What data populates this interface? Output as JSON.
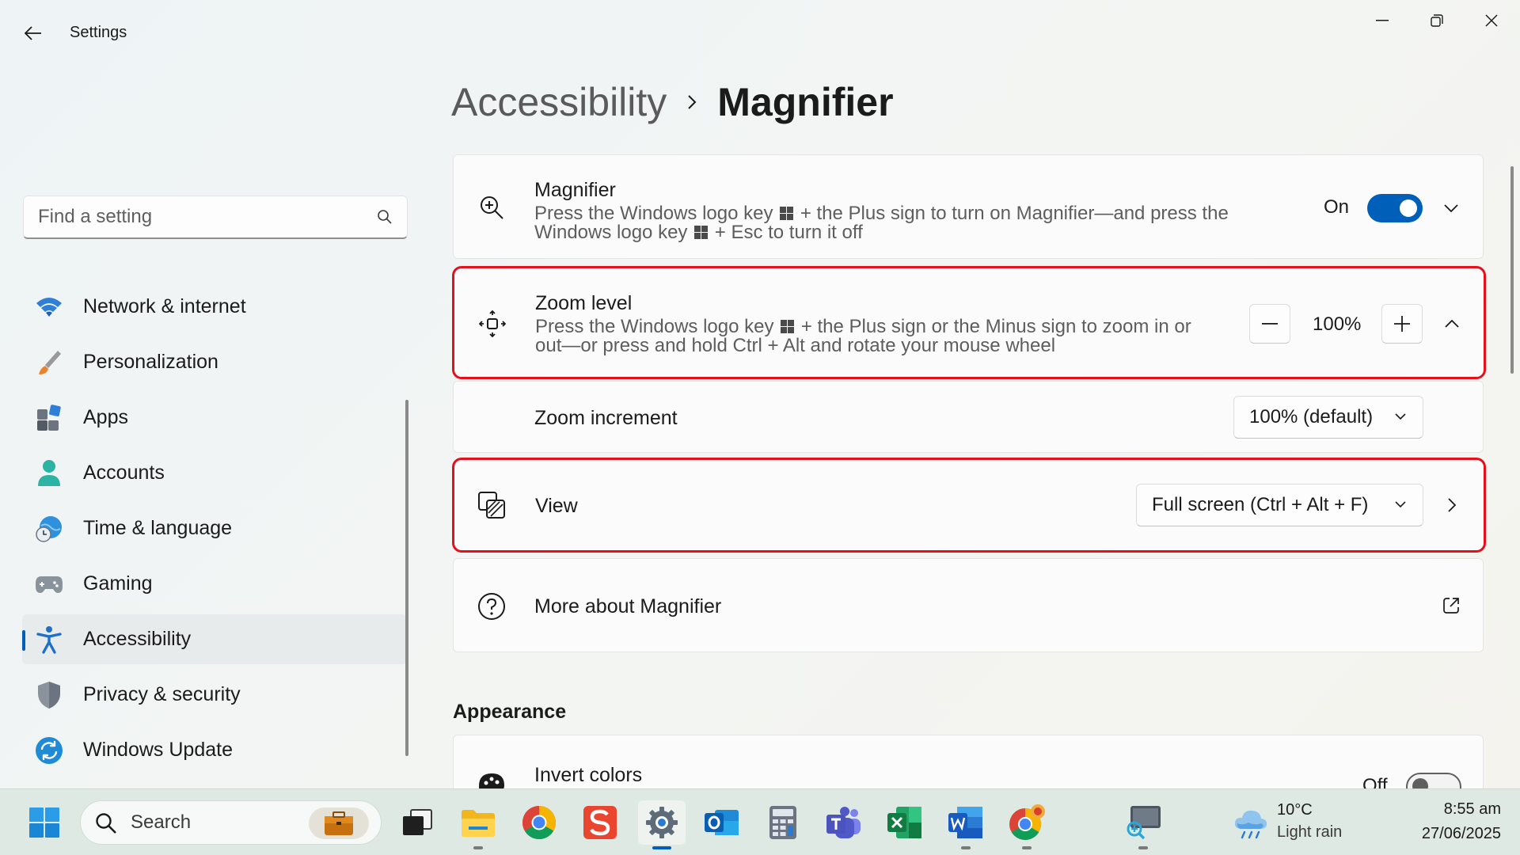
{
  "window": {
    "title": "Settings",
    "back_icon": "arrow-left-icon",
    "controls": [
      "minimize-icon",
      "restore-icon",
      "close-icon"
    ]
  },
  "sidebar": {
    "search_placeholder": "Find a setting",
    "items": [
      {
        "label": "Network & internet",
        "icon": "wifi-icon"
      },
      {
        "label": "Personalization",
        "icon": "brush-icon"
      },
      {
        "label": "Apps",
        "icon": "apps-icon"
      },
      {
        "label": "Accounts",
        "icon": "person-icon"
      },
      {
        "label": "Time & language",
        "icon": "globe-clock-icon"
      },
      {
        "label": "Gaming",
        "icon": "gamepad-icon"
      },
      {
        "label": "Accessibility",
        "icon": "accessibility-icon",
        "selected": true
      },
      {
        "label": "Privacy & security",
        "icon": "shield-icon"
      },
      {
        "label": "Windows Update",
        "icon": "update-icon"
      }
    ]
  },
  "breadcrumb": {
    "parent": "Accessibility",
    "current": "Magnifier"
  },
  "magnifier": {
    "title": "Magnifier",
    "desc_line1_a": "Press the Windows logo key",
    "desc_line1_b": "+ the Plus sign to turn on Magnifier—and press the",
    "desc_line2_a": "Windows logo key",
    "desc_line2_b": "+ Esc to turn it off",
    "toggle_label": "On",
    "toggle_on": true
  },
  "zoom_level": {
    "title": "Zoom level",
    "desc_line1_a": "Press the Windows logo key",
    "desc_line1_b": "+ the Plus sign or the Minus sign to zoom in or",
    "desc_line2": "out—or press and hold Ctrl + Alt and rotate your mouse wheel",
    "value": "100%"
  },
  "zoom_increment": {
    "title": "Zoom increment",
    "selected": "100% (default)"
  },
  "view": {
    "title": "View",
    "selected": "Full screen (Ctrl + Alt + F)"
  },
  "more_about": {
    "title": "More about Magnifier"
  },
  "appearance": {
    "section_title": "Appearance",
    "invert_colors_title": "Invert colors",
    "invert_toggle_label": "Off",
    "invert_on": false
  },
  "taskbar": {
    "search_label": "Search",
    "weather_temp": "10°C",
    "weather_desc": "Light rain",
    "time": "8:55 am",
    "date": "27/06/2025"
  },
  "colors": {
    "accent": "#005fb8",
    "highlight_border": "#e5101c"
  }
}
